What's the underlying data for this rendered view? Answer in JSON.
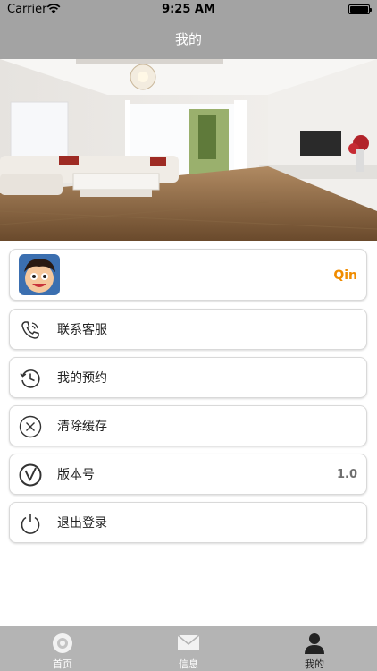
{
  "status_bar": {
    "carrier": "Carrier",
    "time": "9:25 AM"
  },
  "nav": {
    "title": "我的"
  },
  "profile": {
    "username": "Qin"
  },
  "menu": [
    {
      "label": "联系客服",
      "icon": "phone-icon"
    },
    {
      "label": "我的预约",
      "icon": "history-icon"
    },
    {
      "label": "清除缓存",
      "icon": "clear-icon"
    },
    {
      "label": "版本号",
      "icon": "version-icon",
      "value": "1.0"
    },
    {
      "label": "退出登录",
      "icon": "power-icon"
    }
  ],
  "tabs": [
    {
      "label": "首页",
      "icon": "home-icon",
      "active": false
    },
    {
      "label": "信息",
      "icon": "mail-icon",
      "active": false
    },
    {
      "label": "我的",
      "icon": "user-icon",
      "active": true
    }
  ],
  "colors": {
    "bar": "#a3a3a3",
    "tabbar": "#b4b4b4",
    "accent": "#f08c00"
  }
}
